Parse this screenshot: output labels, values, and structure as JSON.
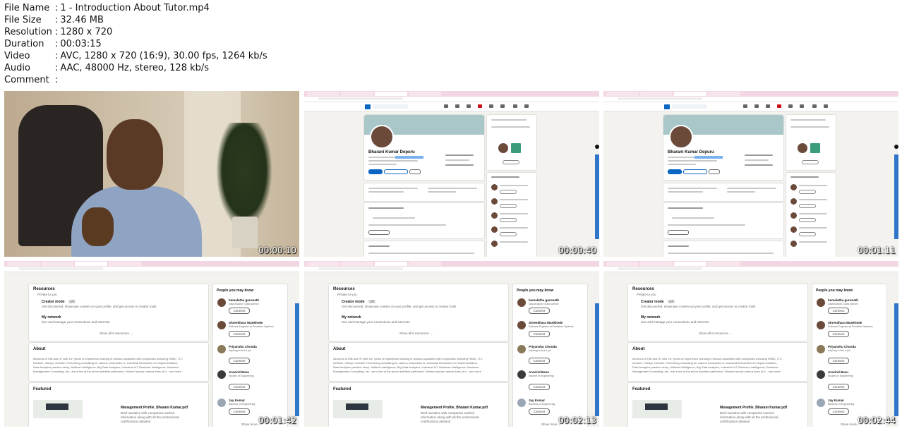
{
  "file_info": [
    {
      "key": "File Name",
      "value": "1 - Introduction About Tutor.mp4"
    },
    {
      "key": "File Size",
      "value": "32.46 MB"
    },
    {
      "key": "Resolution",
      "value": "1280 x 720"
    },
    {
      "key": "Duration",
      "value": "00:03:15"
    },
    {
      "key": "Video",
      "value": "AVC, 1280 x 720 (16:9), 30.00 fps, 1264 kb/s"
    },
    {
      "key": "Audio",
      "value": "AAC, 48000 Hz, stereo, 128 kb/s"
    },
    {
      "key": "Comment",
      "value": ""
    }
  ],
  "separator": ":",
  "thumbnails": [
    {
      "timestamp": "00:00:10"
    },
    {
      "timestamp": "00:00:40"
    },
    {
      "timestamp": "00:01:11"
    },
    {
      "timestamp": "00:01:42"
    },
    {
      "timestamp": "00:02:13"
    },
    {
      "timestamp": "00:02:44"
    }
  ],
  "profile": {
    "name": "Bharani Kumar Depuru",
    "buttons": [
      "Open to",
      "Add profile section",
      "More"
    ],
    "side_title": "People also viewed",
    "message_label": "Message",
    "quiz_title": "Take a skill quiz",
    "analytics_title": "Analytics"
  },
  "resources": {
    "title": "Resources",
    "subtitle": "Private to you",
    "creator_mode": "Creator mode",
    "creator_off": "Off",
    "creator_desc": "Get discovered, showcase content on your profile, and get access to creator tools",
    "network": "My network",
    "network_desc": "See and manage your connections and interests",
    "show_all": "Show all 6 resources →",
    "about_title": "About",
    "about_line1": "Alumnus of ISB and IIT with 16+ years of experience working in various capacities with companies including HSBC, ITC",
    "about_line2": "Infotech, Infosys, Deloitte. Performing consulting for various companies on Industrial Revolution 4.0 implementation,",
    "about_line3": "Data Analytics practice setup, Artificial Intelligence, Big Data Analytics, Industrial IoT, Business Intelligence, Business",
    "about_line4": "Management Consulting, etc., are a few of the prime activities performed. Worked across various lines of b ...see more",
    "featured_title": "Featured",
    "doc_title": "Management Profile_Bharani Kumar.pdf",
    "doc_line1": "Brief narrative with companies worked",
    "doc_line2": "information along with all the professional",
    "doc_line3": "certifications attained",
    "show_more": "Show more ↓"
  },
  "people_you_may_know": {
    "title": "People you may know",
    "connect_label": "Connect",
    "people": [
      {
        "name": "hemalatha gurunath",
        "title": "Data Analyst | Data science"
      },
      {
        "name": "Shreedhara Wankhede",
        "title": "Software Engineer at Persistent Systems"
      },
      {
        "name": "Priyanshu Chooda",
        "title": "Aspiring to find a job"
      },
      {
        "name": "Aravind Basu",
        "title": "Student of Engineering"
      },
      {
        "name": "Jay Kumar",
        "title": "Bachelor of Engineering"
      }
    ]
  }
}
